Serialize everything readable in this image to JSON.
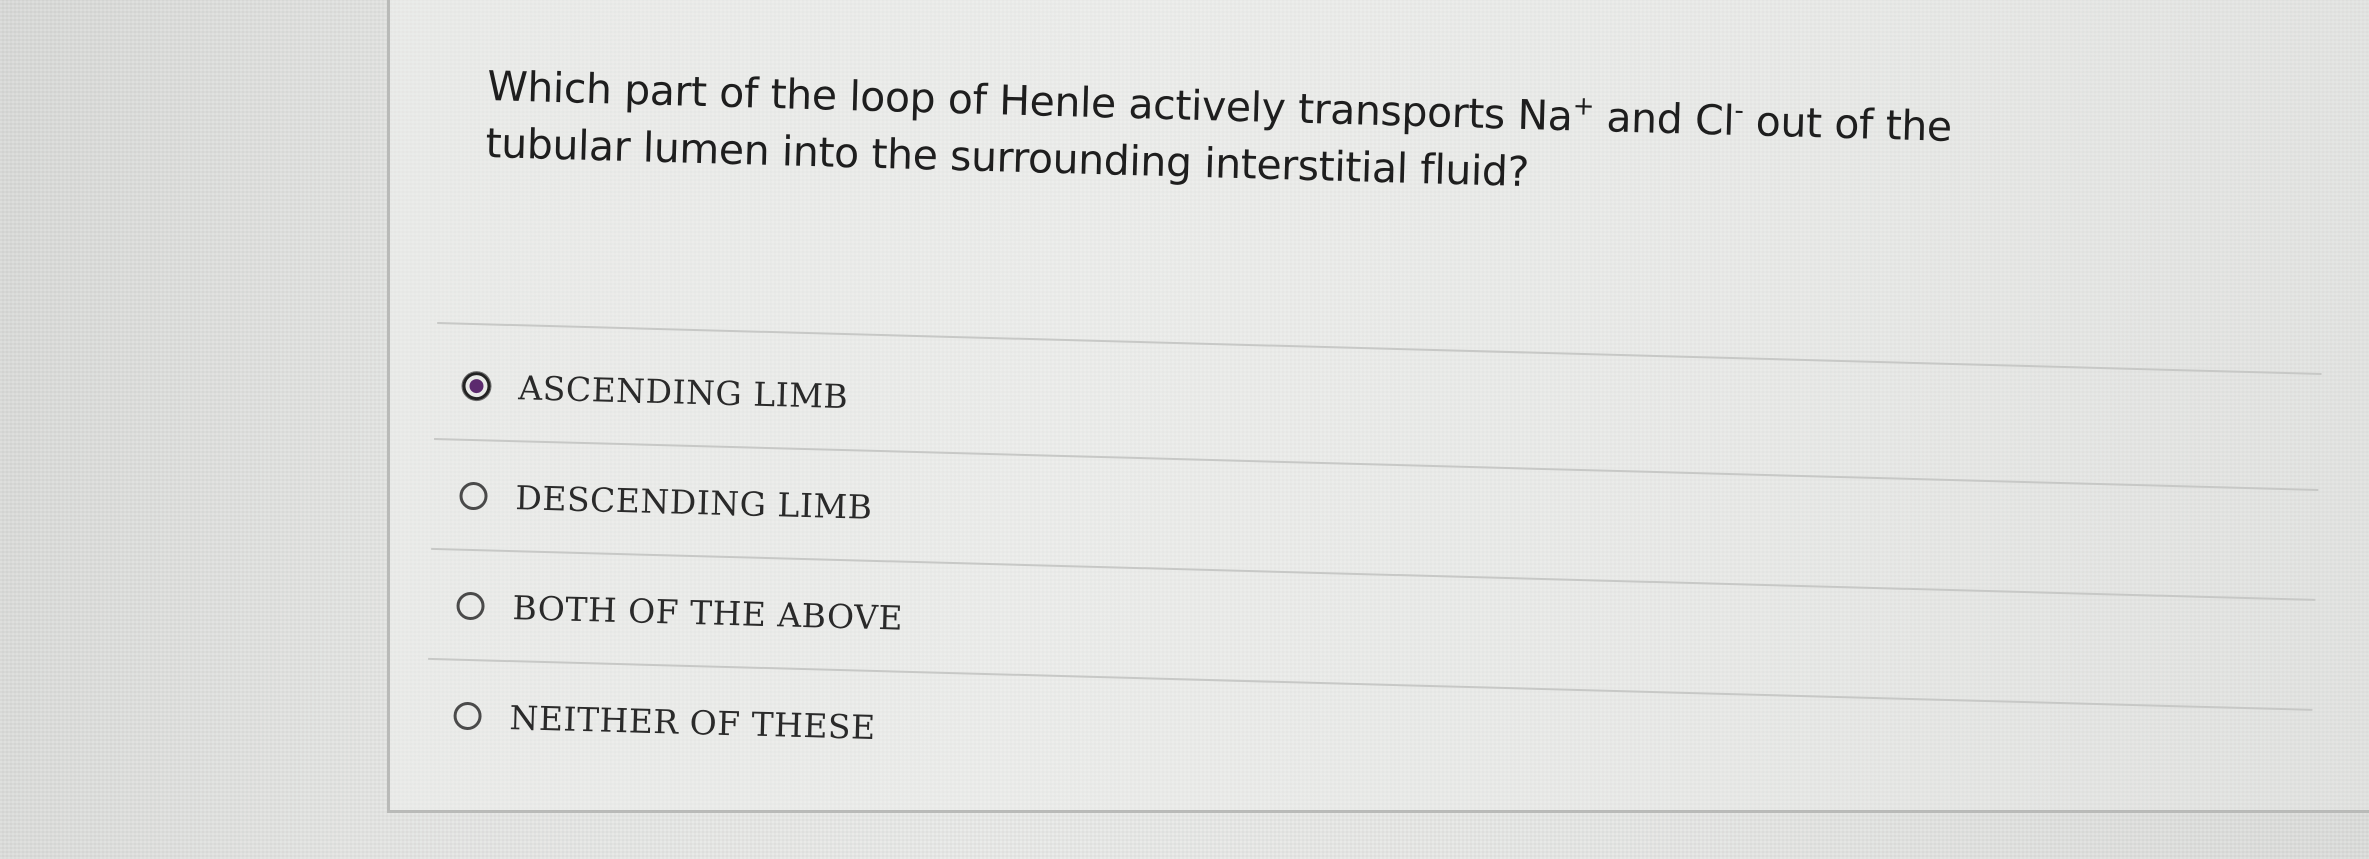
{
  "question": {
    "line1_a": "Which part of the loop of Henle actively transports Na",
    "na_charge": "+",
    "line1_b": " and Cl",
    "cl_charge": "-",
    "line1_c": " out of the",
    "line2": "tubular lumen into the surrounding interstitial fluid?"
  },
  "options": [
    {
      "label": "ASCENDING LIMB",
      "selected": true
    },
    {
      "label": "DESCENDING LIMB",
      "selected": false
    },
    {
      "label": "BOTH OF THE ABOVE",
      "selected": false
    },
    {
      "label": "NEITHER OF THESE",
      "selected": false
    }
  ],
  "colors": {
    "selected_radio": "#5c2a6e",
    "text": "#1e1e1e",
    "background": "#e6e7e5"
  }
}
